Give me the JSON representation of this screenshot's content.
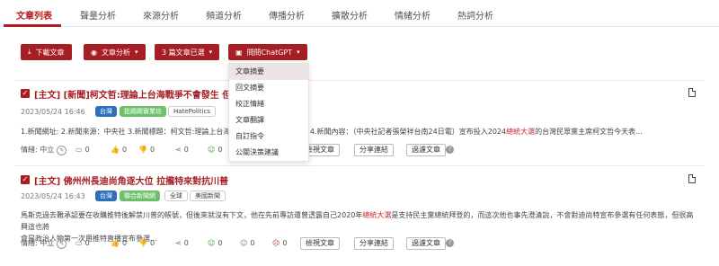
{
  "tabs": [
    "文章列表",
    "聲量分析",
    "來源分析",
    "頻道分析",
    "傳播分析",
    "擴散分析",
    "情緒分析",
    "熱詞分析"
  ],
  "toolbar": {
    "download": "下載文章",
    "analysis": "文章分析",
    "selected": "3 篇文章已選",
    "chatgpt": "問問ChatGPT"
  },
  "dropdown": [
    "文章摘要",
    "回文摘要",
    "校正情緒",
    "文章翻譯",
    "自訂指令",
    "公關決策建議"
  ],
  "articles": [
    {
      "title": "[主文] [新聞]柯文哲:理論上台海戰爭不會發生 但要滿通",
      "date": "2023/05/24 16:46",
      "tags": [
        "台灣",
        "批踢踢實業坊",
        "HatePolitics"
      ],
      "body_pre": "1.新聞網址: 2.新聞來源：中央社 3.新聞標題：柯文哲:理論上台海戰",
      "body_mid": "爭 4.新聞內容：（中央社記者張榮祥台南24日電）宣布投入2024",
      "body_hl": "總統大選",
      "body_post": "的台灣民眾黨主席柯文哲今天表...",
      "sentiment": "情緒: 中立",
      "counts": [
        "0",
        "0",
        "0",
        "0",
        "0",
        "0",
        "0"
      ],
      "view_btn": "檢視文章",
      "share_btn": "分享連結",
      "filter_btn": "過濾文章"
    },
    {
      "title": "[主文] 佛州州長迪尚角逐大位 拉攏特來對抗川普",
      "date": "2023/05/24 16:43",
      "tags": [
        "台灣",
        "聯合新聞網",
        "全球",
        "美國新聞"
      ],
      "body_pre": "馬斯克過去難承認要在收購推特後解禁川普的帳號，但後來就沒有下文，他在先前專訪還曾透露自己2020年",
      "body_hl": "總統大選",
      "body_post": "是支持民主黨總統拜登的，而這次他也事先澄清說，不會對迪尚特宣布參選有任何表態，但很高興這也將",
      "body_line2": "會是政治人物第一次用推特直播宣布參選...",
      "sentiment": "情緒: 中立",
      "counts": [
        "0",
        "0",
        "0",
        "0",
        "0",
        "0",
        "0"
      ],
      "view_btn": "檢視文章",
      "share_btn": "分享連結",
      "filter_btn": "過濾文章"
    }
  ],
  "colors": {
    "accent": "#a61d24",
    "tag_blue": "#2e6fb8",
    "tag_green": "#6cc16a"
  }
}
